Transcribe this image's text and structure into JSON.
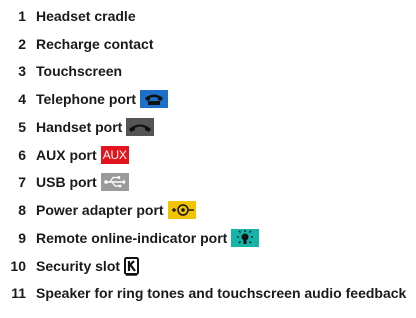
{
  "items": [
    {
      "num": "1",
      "label": "Headset cradle"
    },
    {
      "num": "2",
      "label": "Recharge contact"
    },
    {
      "num": "3",
      "label": "Touchscreen"
    },
    {
      "num": "4",
      "label": "Telephone port",
      "icon": "telephone-icon",
      "color": "#1e6fc8"
    },
    {
      "num": "5",
      "label": "Handset port",
      "icon": "handset-icon",
      "color": "#555555"
    },
    {
      "num": "6",
      "label": "AUX port",
      "icon": "aux-icon",
      "icon_text": "AUX",
      "color": "#e4141c"
    },
    {
      "num": "7",
      "label": "USB port",
      "icon": "usb-icon",
      "color": "#9a9a9a"
    },
    {
      "num": "8",
      "label": "Power adapter port",
      "icon": "power-adapter-icon",
      "color": "#f2c400"
    },
    {
      "num": "9",
      "label": "Remote online-indicator port",
      "icon": "online-indicator-icon",
      "color": "#14b4a8"
    },
    {
      "num": "10",
      "label": "Security slot",
      "icon": "kensington-lock-icon"
    },
    {
      "num": "11",
      "label": "Speaker for ring tones and touchscreen audio feedback"
    }
  ]
}
